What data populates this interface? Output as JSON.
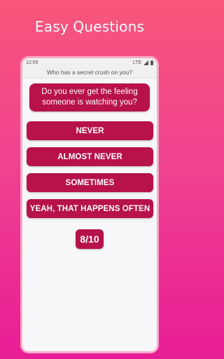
{
  "promo": {
    "title": "Easy Questions"
  },
  "status_bar": {
    "time": "12:05",
    "network": "LTE",
    "icons": [
      "signal-icon",
      "battery-icon"
    ]
  },
  "header": {
    "title": "Who has a secret crush on you?"
  },
  "question": {
    "text": "Do you ever get the feeling someone is watching you?"
  },
  "answers": [
    {
      "label": "NEVER"
    },
    {
      "label": "ALMOST NEVER"
    },
    {
      "label": "SOMETIMES"
    },
    {
      "label": "YEAH, THAT HAPPENS OFTEN"
    }
  ],
  "progress": {
    "label": "8/10",
    "current": 8,
    "total": 10
  },
  "colors": {
    "accent": "#b8124a",
    "background_top": "#f7567a",
    "background_bottom": "#e81d95"
  }
}
